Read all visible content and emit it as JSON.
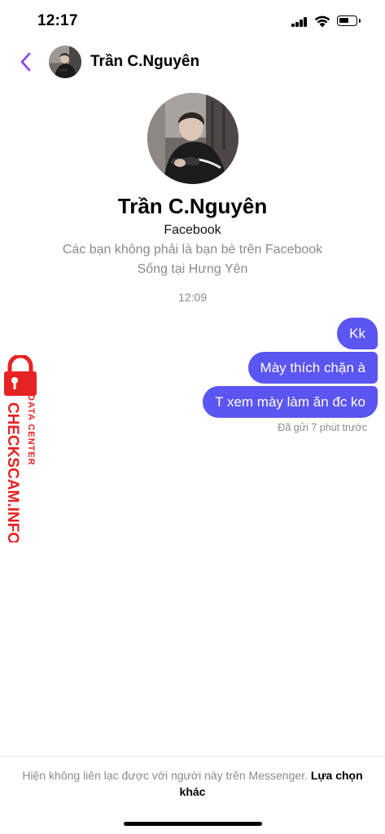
{
  "status_bar": {
    "time": "12:17"
  },
  "header": {
    "name": "Trần C.Nguyên",
    "back_icon": "chevron-left-icon",
    "accent": "#8a3ffc"
  },
  "profile": {
    "name": "Trần C.Nguyên",
    "source": "Facebook",
    "friend_status": "Các bạn không phải là bạn bè trên Facebook",
    "lives_in": "Sống tại Hưng Yên"
  },
  "chat": {
    "timestamp": "12:09",
    "messages": [
      {
        "text": "Kk"
      },
      {
        "text": "Mày thích chặn à"
      },
      {
        "text": "T xem mày làm ăn đc ko"
      }
    ],
    "sent_status": "Đã gửi 7 phút trước",
    "bubble_color": "#5b55f1"
  },
  "watermark": {
    "line1": "DATA CENTER",
    "line2": "CHECKSCAM.INFO",
    "color": "#e52323"
  },
  "footer": {
    "notice": "Hiện không liên lạc được với người này trên Messenger.",
    "link": "Lựa chọn khác"
  }
}
